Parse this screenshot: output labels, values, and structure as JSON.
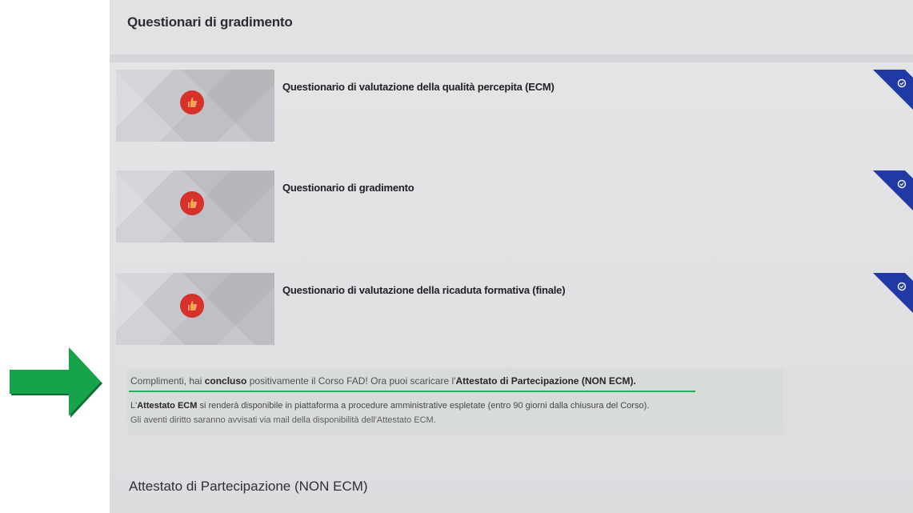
{
  "header": {
    "title": "Questionari di gradimento"
  },
  "questionnaires": [
    {
      "title": "Questionario di valutazione della qualità percepita (ECM)",
      "icon": "thumbs-up-icon",
      "completed": true
    },
    {
      "title": "Questionario di gradimento",
      "icon": "thumbs-up-icon",
      "completed": true
    },
    {
      "title": "Questionario di valutazione della ricaduta formativa (finale)",
      "icon": "thumbs-up-icon",
      "completed": true
    }
  ],
  "notice": {
    "line1_a": "Complimenti, hai ",
    "line1_b": "concluso",
    "line1_c": " positivamente il Corso FAD! Ora puoi scaricare l'",
    "line1_d": "Attestato di Partecipazione (NON ECM).",
    "line2_a": "L'",
    "line2_b": "Attestato ECM",
    "line2_c": " si renderà disponibile in piattaforma a procedure amministrative espletate (entro 90 giorni dalla chiusura del Corso).",
    "line3": "Gli aventi diritto saranno avvisati via mail della disponibilità dell'Attestato ECM."
  },
  "section": {
    "title": "Attestato di Partecipazione (NON ECM)"
  },
  "colors": {
    "arrow": "#17a34a",
    "badge": "#d6322b",
    "corner": "#1f3aa5",
    "underline": "#23b05a"
  }
}
